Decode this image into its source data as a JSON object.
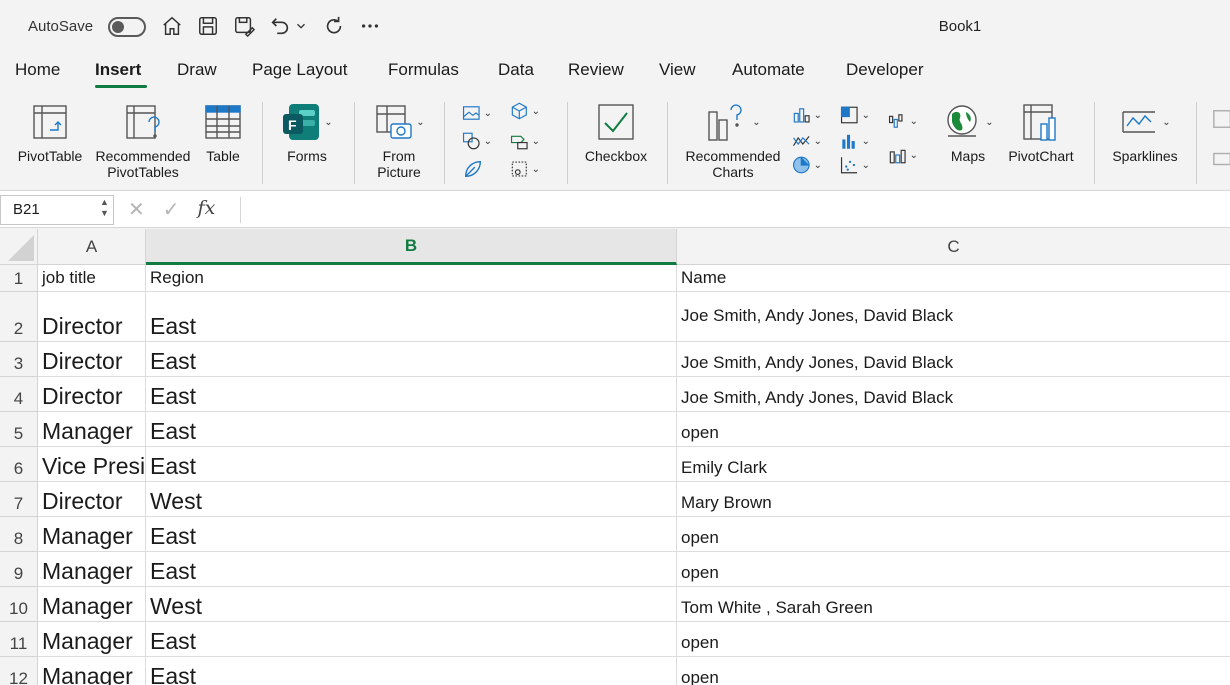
{
  "titlebar": {
    "autosave_label": "AutoSave",
    "doc_title": "Book1",
    "icons": [
      "home-icon",
      "save-icon",
      "save-as-icon",
      "undo-icon",
      "redo-icon",
      "more-icon"
    ]
  },
  "tabs": [
    "Home",
    "Insert",
    "Draw",
    "Page Layout",
    "Formulas",
    "Data",
    "Review",
    "View",
    "Automate",
    "Developer"
  ],
  "active_tab": "Insert",
  "ribbon": {
    "pivottable": "PivotTable",
    "recommended_pivottables_1": "Recommended",
    "recommended_pivottables_2": "PivotTables",
    "table": "Table",
    "forms": "Forms",
    "from_picture_1": "From",
    "from_picture_2": "Picture",
    "checkbox": "Checkbox",
    "recommended_charts_1": "Recommended",
    "recommended_charts_2": "Charts",
    "maps": "Maps",
    "pivotchart": "PivotChart",
    "sparklines": "Sparklines"
  },
  "formula_bar": {
    "name_box": "B21",
    "fx_label": "fx",
    "value": ""
  },
  "sheet": {
    "columns": [
      "A",
      "B",
      "C"
    ],
    "selected_column": "B",
    "rows": [
      {
        "n": "1",
        "a": "job title",
        "b": "Region",
        "c": "Name"
      },
      {
        "n": "2",
        "a": "Director",
        "b": "East",
        "c": "Joe Smith, Andy Jones, David Black"
      },
      {
        "n": "3",
        "a": "Director",
        "b": "East",
        "c": "Joe Smith, Andy Jones, David Black"
      },
      {
        "n": "4",
        "a": "Director",
        "b": "East",
        "c": "Joe Smith, Andy Jones, David Black"
      },
      {
        "n": "5",
        "a": "Manager",
        "b": "East",
        "c": "open"
      },
      {
        "n": "6",
        "a": "Vice President",
        "b": "East",
        "c": "Emily Clark"
      },
      {
        "n": "7",
        "a": "Director",
        "b": "West",
        "c": "Mary Brown"
      },
      {
        "n": "8",
        "a": "Manager",
        "b": "East",
        "c": "open"
      },
      {
        "n": "9",
        "a": "Manager",
        "b": "East",
        "c": "open"
      },
      {
        "n": "10",
        "a": "Manager",
        "b": "West",
        "c": "Tom White , Sarah Green"
      },
      {
        "n": "11",
        "a": "Manager",
        "b": "East",
        "c": "open"
      },
      {
        "n": "12",
        "a": "Manager",
        "b": "East",
        "c": "open"
      }
    ]
  },
  "colors": {
    "accent": "#107c41",
    "ribbon_bg": "#f3f3f3",
    "grid_line": "#dcdcdc"
  }
}
